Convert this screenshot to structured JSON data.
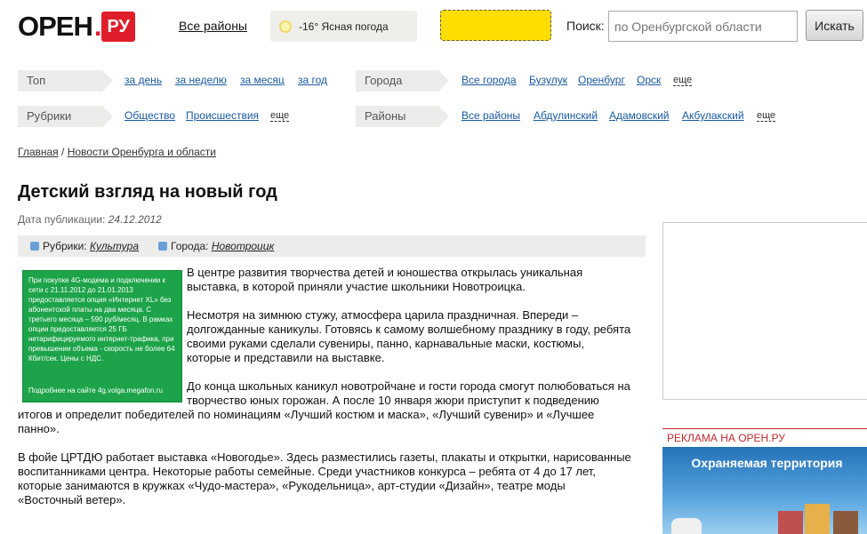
{
  "header": {
    "logo_text": "ОРЕН",
    "logo_domain": "РУ",
    "all_regions": "Все районы",
    "weather": "-16° Ясная погода",
    "search_label": "Поиск:",
    "search_placeholder": "по Оренбургской области",
    "search_button": "Искать"
  },
  "nav": {
    "top": {
      "label": "Топ",
      "links": [
        "за день",
        "за неделю",
        "за месяц",
        "за год"
      ]
    },
    "cities": {
      "label": "Города",
      "links": [
        "Все города",
        "Бузулук",
        "Оренбург",
        "Орск"
      ],
      "more": "еще"
    },
    "rubrics": {
      "label": "Рубрики",
      "links": [
        "Общество",
        "Происшествия"
      ],
      "more": "еще"
    },
    "districts": {
      "label": "Районы",
      "links": [
        "Все районы",
        "Абдулинский",
        "Адамовский",
        "Акбулакский"
      ],
      "more": "еще"
    }
  },
  "breadcrumb": {
    "home": "Главная",
    "separator": " / ",
    "section": "Новости Оренбурга и области"
  },
  "article": {
    "title": "Детский взгляд на новый год",
    "pub_label": "Дата публикации:",
    "pub_date": "24.12.2012",
    "rubric_label": "Рубрики:",
    "rubric_value": "Культура",
    "city_label": "Города:",
    "city_value": "Новотроицк",
    "paragraphs": [
      "В центре развития творчества детей и юношества открылась уникальная выставка, в  которой приняли участие школьники Новотроицка.",
      "Несмотря на зимнюю стужу, атмосфера царила праздничная. Впереди – долгожданные каникулы. Готовясь к самому волшебному празднику в году, ребята своими руками сделали сувениры, панно, карнавальные маски, костюмы, которые и представили на выставке.",
      "До конца  школьных каникул новотройчане и  гости города смогут полюбоваться на творчество юных горожан. А после 10 января жюри приступит к подведению итогов и определит победителей по номинациям «Лучший костюм и маска», «Лучший сувенир» и «Лучшее панно».",
      "В фойе ЦРТДЮ  работает выставка «Новогодье». Здесь  разместились газеты, плакаты и открытки, нарисованные воспитанниками центра. Некоторые работы семейные. Среди участников конкурса – ребята от 4 до 17 лет, которые занимаются в кружках «Чудо-мастера», «Рукодельница», арт-студии «Дизайн», театре моды «Восточный ветер»."
    ]
  },
  "ad_green": {
    "text": "При покупке 4G-модема и подключении к сети с 21.11.2012 до 21.01.2013 предоставляется опция «Интернет XL» без абонентской платы на два месяца. С третьего месяца – 590 руб/месяц. В рамках опции предоставляется 25 ГБ нетарифицируемого интернет-трафика, при превышении объема - скорость не более 64 Кбит/сек. Цены с НДС.",
    "footer": "Подробнее на сайте 4g.volga.megafon.ru"
  },
  "sidebar": {
    "adv_label": "РЕКЛАМА НА ОРЕН.РУ",
    "banner_title": "Охраняемая территория"
  },
  "colors": {
    "brand_red": "#e01e2b",
    "link": "#1a5aa0",
    "ad_green": "#1da349",
    "weather_bg": "#eeeeea"
  }
}
